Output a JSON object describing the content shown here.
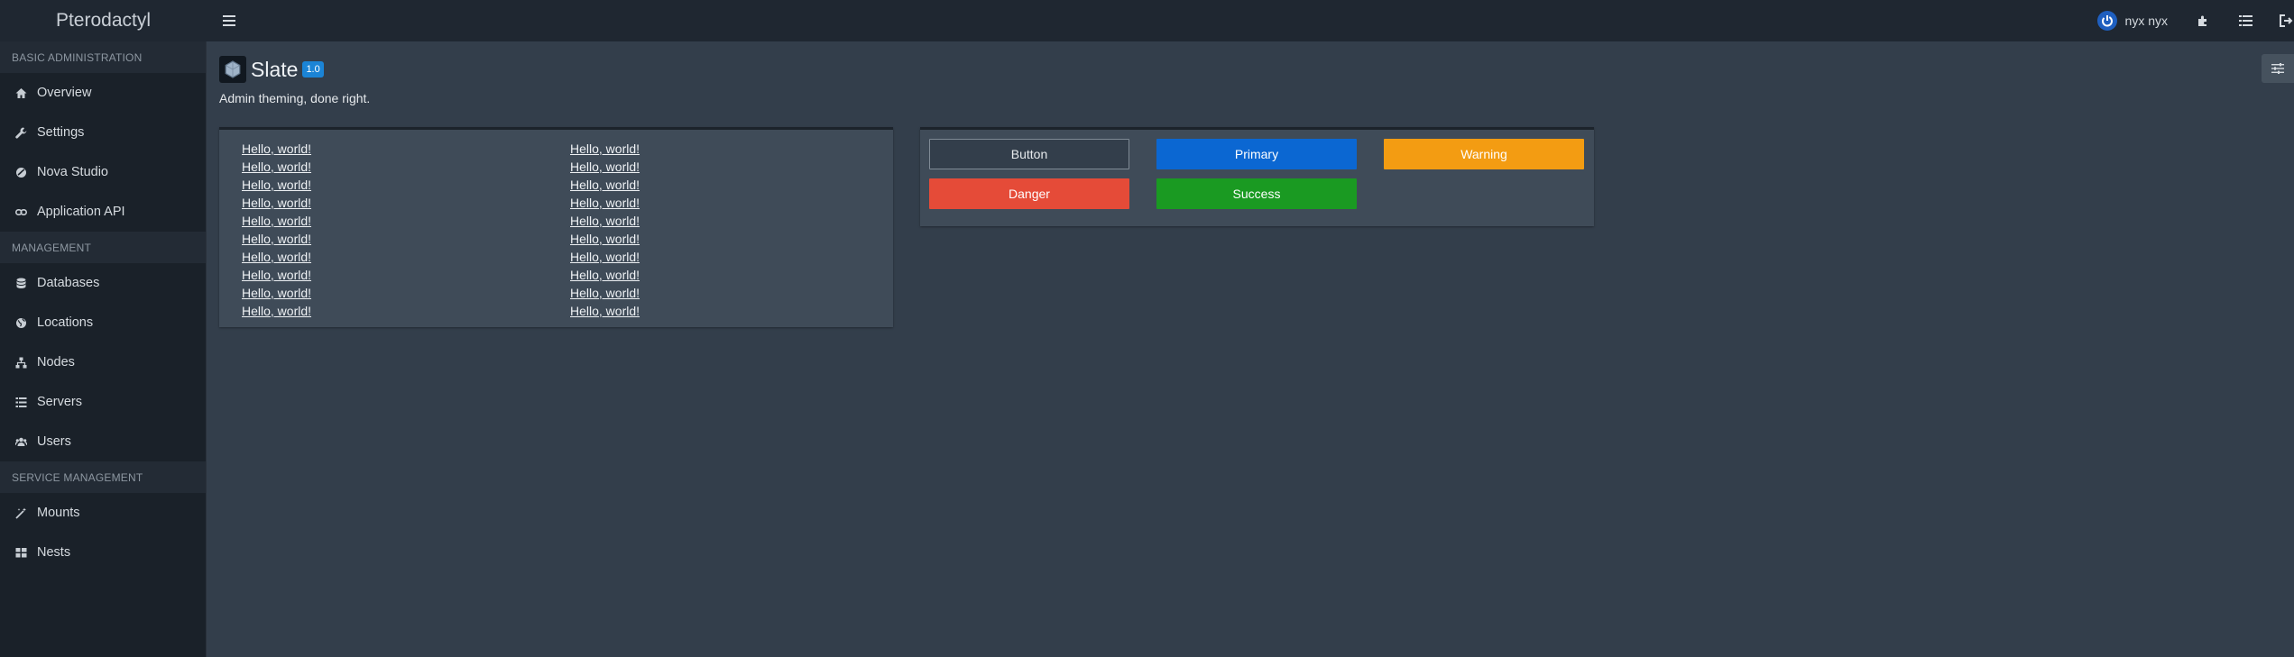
{
  "header": {
    "brand": "Pterodactyl",
    "user_name": "nyx nyx",
    "icons": [
      "menu-icon",
      "power-icon",
      "puzzle-icon",
      "list-icon",
      "logout-icon"
    ]
  },
  "sidebar": {
    "sections": [
      {
        "title": "BASIC ADMINISTRATION",
        "items": [
          {
            "label": "Overview",
            "icon": "home-icon"
          },
          {
            "label": "Settings",
            "icon": "wrench-icon"
          },
          {
            "label": "Nova Studio",
            "icon": "brush-icon"
          },
          {
            "label": "Application API",
            "icon": "link-icon"
          }
        ]
      },
      {
        "title": "MANAGEMENT",
        "items": [
          {
            "label": "Databases",
            "icon": "database-icon"
          },
          {
            "label": "Locations",
            "icon": "globe-icon"
          },
          {
            "label": "Nodes",
            "icon": "sitemap-icon"
          },
          {
            "label": "Servers",
            "icon": "server-icon"
          },
          {
            "label": "Users",
            "icon": "users-icon"
          }
        ]
      },
      {
        "title": "SERVICE MANAGEMENT",
        "items": [
          {
            "label": "Mounts",
            "icon": "magic-icon"
          },
          {
            "label": "Nests",
            "icon": "grid-icon"
          }
        ]
      }
    ]
  },
  "page": {
    "title": "Slate",
    "version": "1.0",
    "subtitle": "Admin theming, done right."
  },
  "links": {
    "col1": [
      "Hello, world!",
      "Hello, world!",
      "Hello, world!",
      "Hello, world!",
      "Hello, world!",
      "Hello, world!",
      "Hello, world!",
      "Hello, world!",
      "Hello, world!",
      "Hello, world!"
    ],
    "col2": [
      "Hello, world!",
      "Hello, world!",
      "Hello, world!",
      "Hello, world!",
      "Hello, world!",
      "Hello, world!",
      "Hello, world!",
      "Hello, world!",
      "Hello, world!",
      "Hello, world!"
    ]
  },
  "buttons": {
    "default": "Button",
    "primary": "Primary",
    "warning": "Warning",
    "danger": "Danger",
    "success": "Success"
  },
  "colors": {
    "primary": "#0b67d2",
    "warning": "#f39c12",
    "danger": "#e54b38",
    "success": "#1a9a22",
    "badge": "#1b84d6"
  }
}
